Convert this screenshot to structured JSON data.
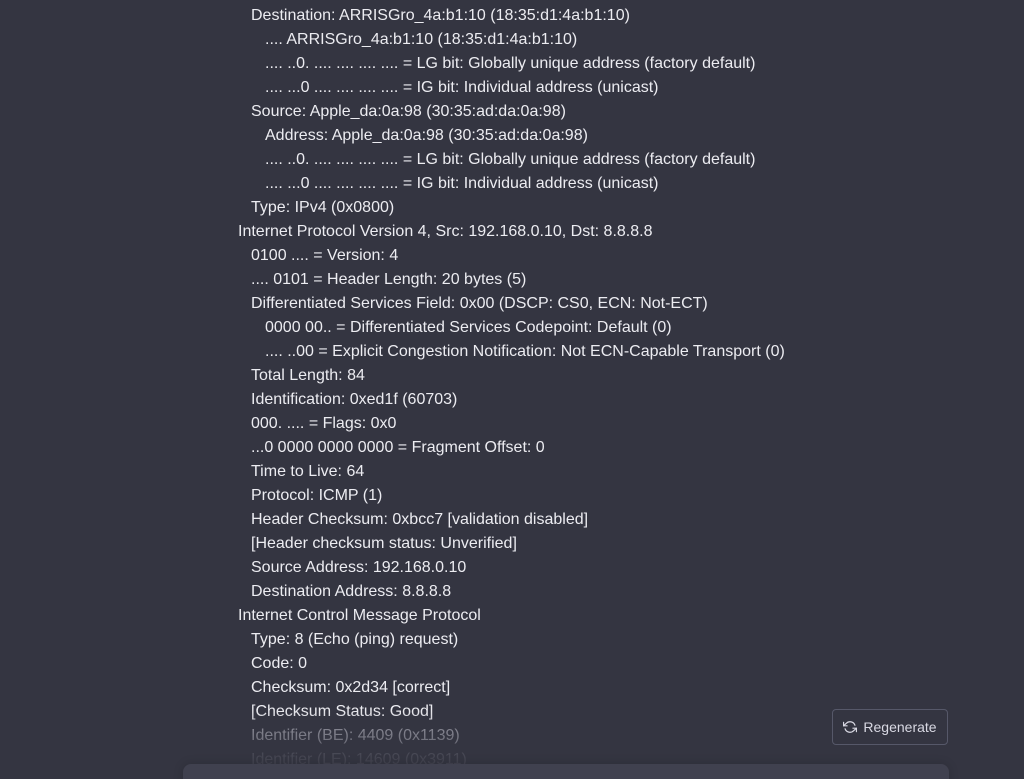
{
  "packet_lines": [
    {
      "level": 1,
      "text": "Destination: ARRISGro_4a:b1:10 (18:35:d1:4a:b1:10)"
    },
    {
      "level": 2,
      "text": ".... ARRISGro_4a:b1:10 (18:35:d1:4a:b1:10)"
    },
    {
      "level": 2,
      "text": ".... ..0. .... .... .... .... = LG bit: Globally unique address (factory default)"
    },
    {
      "level": 2,
      "text": ".... ...0 .... .... .... .... = IG bit: Individual address (unicast)"
    },
    {
      "level": 1,
      "text": "Source: Apple_da:0a:98 (30:35:ad:da:0a:98)"
    },
    {
      "level": 2,
      "text": "Address: Apple_da:0a:98 (30:35:ad:da:0a:98)"
    },
    {
      "level": 2,
      "text": ".... ..0. .... .... .... .... = LG bit: Globally unique address (factory default)"
    },
    {
      "level": 2,
      "text": ".... ...0 .... .... .... .... = IG bit: Individual address (unicast)"
    },
    {
      "level": 1,
      "text": "Type: IPv4 (0x0800)"
    },
    {
      "level": 0,
      "text": "Internet Protocol Version 4, Src: 192.168.0.10, Dst: 8.8.8.8"
    },
    {
      "level": 1,
      "text": "0100 .... = Version: 4"
    },
    {
      "level": 1,
      "text": ".... 0101 = Header Length: 20 bytes (5)"
    },
    {
      "level": 1,
      "text": "Differentiated Services Field: 0x00 (DSCP: CS0, ECN: Not-ECT)"
    },
    {
      "level": 2,
      "text": "0000 00.. = Differentiated Services Codepoint: Default (0)"
    },
    {
      "level": 2,
      "text": ".... ..00 = Explicit Congestion Notification: Not ECN-Capable Transport (0)"
    },
    {
      "level": 1,
      "text": "Total Length: 84"
    },
    {
      "level": 1,
      "text": "Identification: 0xed1f (60703)"
    },
    {
      "level": 1,
      "text": "000. .... = Flags: 0x0"
    },
    {
      "level": 1,
      "text": "...0 0000 0000 0000 = Fragment Offset: 0"
    },
    {
      "level": 1,
      "text": "Time to Live: 64"
    },
    {
      "level": 1,
      "text": "Protocol: ICMP (1)"
    },
    {
      "level": 1,
      "text": "Header Checksum: 0xbcc7 [validation disabled]"
    },
    {
      "level": 1,
      "text": "[Header checksum status: Unverified]"
    },
    {
      "level": 1,
      "text": "Source Address: 192.168.0.10"
    },
    {
      "level": 1,
      "text": "Destination Address: 8.8.8.8"
    },
    {
      "level": 0,
      "text": "Internet Control Message Protocol"
    },
    {
      "level": 1,
      "text": "Type: 8 (Echo (ping) request)"
    },
    {
      "level": 1,
      "text": "Code: 0"
    },
    {
      "level": 1,
      "text": "Checksum: 0x2d34 [correct]"
    },
    {
      "level": 1,
      "text": "[Checksum Status: Good]"
    },
    {
      "level": 1,
      "text": "Identifier (BE): 4409 (0x1139)",
      "fade": 1
    },
    {
      "level": 1,
      "text": "Identifier (LE): 14609 (0x3911)",
      "fade": 2
    }
  ],
  "regenerate": {
    "label": "Regenerate",
    "icon": "refresh-icon"
  },
  "colors": {
    "background": "#343541",
    "text": "#ececf1",
    "button_border": "#565869",
    "composer": "#40414f"
  }
}
